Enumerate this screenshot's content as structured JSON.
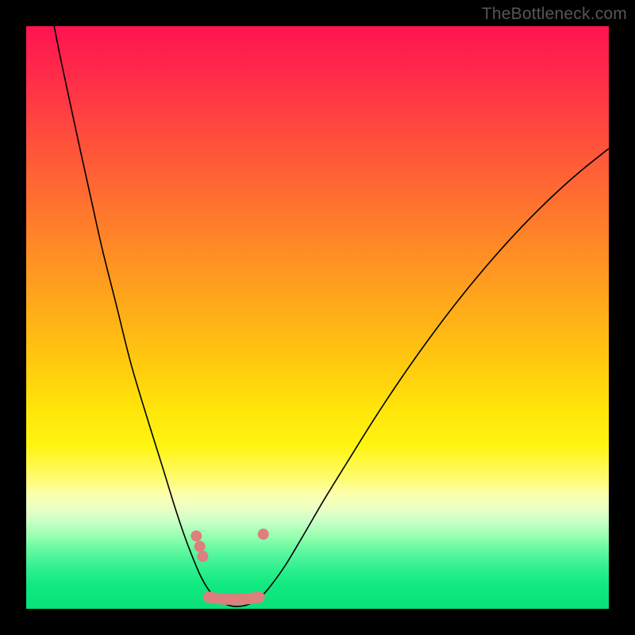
{
  "watermark": "TheBottleneck.com",
  "chart_data": {
    "type": "line",
    "title": "",
    "xlabel": "",
    "ylabel": "",
    "xlim": [
      0,
      1
    ],
    "ylim": [
      0,
      1
    ],
    "series": [
      {
        "name": "curve",
        "points": [
          [
            0.048,
            1.0
          ],
          [
            0.06,
            0.94
          ],
          [
            0.075,
            0.87
          ],
          [
            0.09,
            0.8
          ],
          [
            0.11,
            0.71
          ],
          [
            0.13,
            0.62
          ],
          [
            0.155,
            0.52
          ],
          [
            0.18,
            0.42
          ],
          [
            0.21,
            0.32
          ],
          [
            0.235,
            0.24
          ],
          [
            0.255,
            0.175
          ],
          [
            0.27,
            0.13
          ],
          [
            0.285,
            0.09
          ],
          [
            0.3,
            0.055
          ],
          [
            0.315,
            0.03
          ],
          [
            0.33,
            0.015
          ],
          [
            0.345,
            0.007
          ],
          [
            0.36,
            0.004
          ],
          [
            0.38,
            0.007
          ],
          [
            0.4,
            0.018
          ],
          [
            0.42,
            0.04
          ],
          [
            0.445,
            0.075
          ],
          [
            0.475,
            0.125
          ],
          [
            0.51,
            0.185
          ],
          [
            0.55,
            0.25
          ],
          [
            0.6,
            0.33
          ],
          [
            0.65,
            0.405
          ],
          [
            0.7,
            0.475
          ],
          [
            0.75,
            0.54
          ],
          [
            0.8,
            0.6
          ],
          [
            0.85,
            0.655
          ],
          [
            0.9,
            0.705
          ],
          [
            0.95,
            0.75
          ],
          [
            1.0,
            0.79
          ]
        ]
      }
    ],
    "markers": {
      "left_dots": [
        [
          0.292,
          0.125
        ],
        [
          0.298,
          0.107
        ],
        [
          0.303,
          0.09
        ]
      ],
      "right_dot": [
        0.407,
        0.128
      ],
      "bottom_band": [
        [
          0.313,
          0.02
        ],
        [
          0.4,
          0.02
        ]
      ]
    },
    "colors": {
      "curve": "#000000",
      "marker": "#dd7f7d",
      "gradient_top": "#ff1450",
      "gradient_mid": "#ffe60a",
      "gradient_bottom": "#08e078"
    }
  }
}
